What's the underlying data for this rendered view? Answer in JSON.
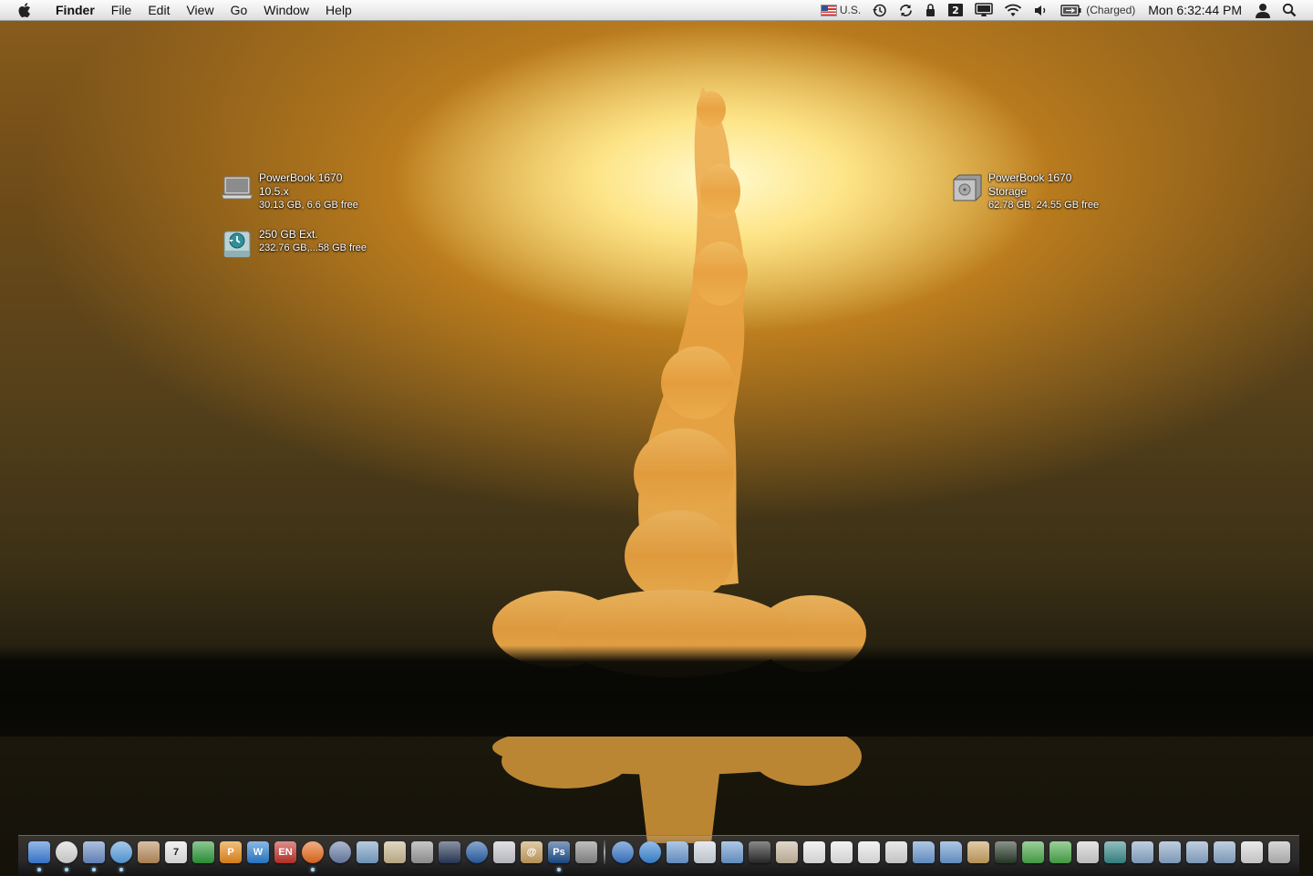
{
  "menubar": {
    "app_name": "Finder",
    "menus": [
      "File",
      "Edit",
      "View",
      "Go",
      "Window",
      "Help"
    ],
    "input_source": "U.S.",
    "battery_status": "(Charged)",
    "clock": "Mon 6:32:44 PM"
  },
  "desktop": {
    "icons": [
      {
        "name": "PowerBook 1670\n10.5.x",
        "info": "30.13 GB, 6.6 GB free",
        "icon": "laptop-icon"
      },
      {
        "name": "250 GB Ext.",
        "info": "232.76 GB,...58 GB free",
        "icon": "time-machine-drive-icon"
      },
      {
        "name": "PowerBook 1670\nStorage",
        "info": "62.78 GB, 24.55 GB free",
        "icon": "hard-drive-icon"
      }
    ]
  },
  "dock": {
    "items": [
      {
        "icon": "finder-icon",
        "label": "",
        "color": "#3b7ed8",
        "running": true
      },
      {
        "icon": "dashboard-icon",
        "label": "",
        "color": "#d8d8d8",
        "running": true
      },
      {
        "icon": "mail-icon",
        "label": "",
        "color": "#6b8cc7",
        "running": true
      },
      {
        "icon": "safari-icon",
        "label": "",
        "color": "#5aa0e0",
        "running": true
      },
      {
        "icon": "address-book-icon",
        "label": "",
        "color": "#b98c5c",
        "running": false
      },
      {
        "icon": "ical-icon",
        "label": "7",
        "color": "#e8e8e8",
        "running": false
      },
      {
        "icon": "app-green-icon",
        "label": "",
        "color": "#2e9a3a",
        "running": false
      },
      {
        "icon": "app-p-icon",
        "label": "P",
        "color": "#e88a1a",
        "running": false
      },
      {
        "icon": "app-w-icon",
        "label": "W",
        "color": "#2a7fd1",
        "running": false
      },
      {
        "icon": "app-en-icon",
        "label": "EN",
        "color": "#c2322a",
        "running": false
      },
      {
        "icon": "firefox-icon",
        "label": "",
        "color": "#e86b1e",
        "running": true
      },
      {
        "icon": "globe-app-icon",
        "label": "",
        "color": "#6a7fa8",
        "running": false
      },
      {
        "icon": "iphoto-icon",
        "label": "",
        "color": "#7aa2c8",
        "running": false
      },
      {
        "icon": "preview-icon",
        "label": "",
        "color": "#c8b890",
        "running": false
      },
      {
        "icon": "printer-icon",
        "label": "",
        "color": "#9a9a9a",
        "running": false
      },
      {
        "icon": "activity-monitor-icon",
        "label": "",
        "color": "#2a3a5a",
        "running": false
      },
      {
        "icon": "quicktime-icon",
        "label": "",
        "color": "#2a5fa8",
        "running": false
      },
      {
        "icon": "utility-icon",
        "label": "",
        "color": "#c8c8d0",
        "running": false
      },
      {
        "icon": "address-icon",
        "label": "@",
        "color": "#c8a060",
        "running": false
      },
      {
        "icon": "photoshop-icon",
        "label": "Ps",
        "color": "#1d4f8a",
        "running": true
      },
      {
        "icon": "system-preferences-icon",
        "label": "",
        "color": "#8a8a8a",
        "running": false
      },
      {
        "icon": "network-globe-icon",
        "label": "",
        "color": "#3a78c8",
        "running": false
      },
      {
        "icon": "network-globe-icon",
        "label": "",
        "color": "#3a88d8",
        "running": false
      },
      {
        "icon": "folder-icon",
        "label": "",
        "color": "#6c9ad0",
        "running": false
      },
      {
        "icon": "monitor-icon",
        "label": "",
        "color": "#d0d8e0",
        "running": false
      },
      {
        "icon": "folder-icon",
        "label": "",
        "color": "#6c9ad0",
        "running": false
      },
      {
        "icon": "document-icon",
        "label": "",
        "color": "#2a2a2a",
        "running": false
      },
      {
        "icon": "home-icon",
        "label": "",
        "color": "#c8b8a0",
        "running": false
      },
      {
        "icon": "document-icon",
        "label": "",
        "color": "#e8e8e8",
        "running": false
      },
      {
        "icon": "document-icon",
        "label": "",
        "color": "#e8e8e8",
        "running": false
      },
      {
        "icon": "document-icon",
        "label": "",
        "color": "#e8e8e8",
        "running": false
      },
      {
        "icon": "stop-sign-icon",
        "label": "",
        "color": "#d8d8d8",
        "running": false
      },
      {
        "icon": "folder-icon",
        "label": "",
        "color": "#6c9ad0",
        "running": false
      },
      {
        "icon": "folder-icon",
        "label": "",
        "color": "#6c9ad0",
        "running": false
      },
      {
        "icon": "address-icon",
        "label": "",
        "color": "#c8a060",
        "running": false
      },
      {
        "icon": "terminal-icon",
        "label": "",
        "color": "#2a3a2a",
        "running": false
      },
      {
        "icon": "download-icon",
        "label": "",
        "color": "#4aa84a",
        "running": false
      },
      {
        "icon": "download-icon",
        "label": "",
        "color": "#4aa84a",
        "running": false
      },
      {
        "icon": "disk-image-icon",
        "label": "",
        "color": "#d0d0d0",
        "running": false
      },
      {
        "icon": "time-machine-icon",
        "label": "",
        "color": "#3a8a8a",
        "running": false
      },
      {
        "icon": "network-drive-icon",
        "label": "",
        "color": "#8aa8c8",
        "running": false
      },
      {
        "icon": "network-drive-icon",
        "label": "",
        "color": "#8aa8c8",
        "running": false
      },
      {
        "icon": "network-drive-icon",
        "label": "",
        "color": "#8aa8c8",
        "running": false
      },
      {
        "icon": "network-drive-icon",
        "label": "",
        "color": "#8aa8c8",
        "running": false
      },
      {
        "icon": "document-icon",
        "label": "",
        "color": "#d8d8d8",
        "running": false
      },
      {
        "icon": "trash-icon",
        "label": "",
        "color": "#b8b8b8",
        "running": false
      }
    ]
  }
}
